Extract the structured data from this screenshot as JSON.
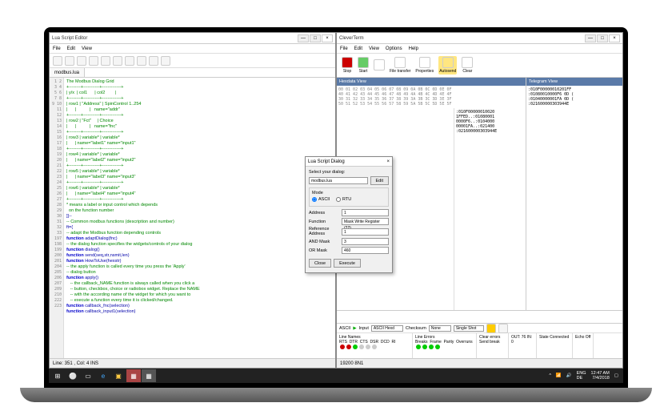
{
  "left_window": {
    "title": "Lua Script Editor",
    "menu": [
      "File",
      "Edit",
      "View"
    ],
    "tab": "modbus.lua",
    "status": "Line: 351 , Col: 4   INS",
    "code_lines": [
      "",
      "The Modbus Dialog Grid",
      "",
      "+--------+-----------+-------------+",
      "| y/x  | col1      | col2        |",
      "+--------+-----------+-------------+",
      "| row1 | \"Address\" | SpinControl 1..254",
      "|      |           |   name=\"addr\"",
      "+--------+-----------+-------------+",
      "| row2 | \"Fct\"     | Choice",
      "|      |           |   name=\"fnc\"",
      "+--------+-----------+-------------+",
      "| row3 | variable* | variable*",
      "|      | name=\"label1\" name=\"input1\"",
      "+--------+-----------+-------------+",
      "| row4 | variable* | variable*",
      "|      | name=\"label2\" name=\"input2\"",
      "+--------+-----------+-------------+",
      "| row5 | variable* | variable*",
      "|      | name=\"label3\" name=\"input3\"",
      "+--------+-----------+-------------+",
      "| row6 | variable* | variable*",
      "|      | name=\"label4\" name=\"input4\"",
      "+--------+-----------+-------------+",
      "",
      "* means a label or input control which depends",
      "  on the function number",
      "]]--",
      "",
      "-- Common modbus functions (description and number)",
      "ft={",
      "-- adapt the Modbus function depending controls",
      "function adaptDialog(fnc)",
      "-- the dialog function specifies the widgets/controls of your dialog",
      "function dialog()",
      "function send(seq,str,nsmit,len)",
      "function HowToUse(hexstr)",
      "-- the apply function is called every time you press the 'Apply'",
      "-- dialog button",
      "function apply()",
      "   -- the callback_NAME function is always called when you click a",
      "   -- button, checkbox, choice or radiobox widget. Replace the NAME",
      "   -- with the according name of the widget for which you want to",
      "   -- execute a function every time it is clicked/changed.",
      "function callback_fnc(selection)",
      "function callback_input1(selection)"
    ]
  },
  "right_window": {
    "title": "CleverTerm",
    "menu": [
      "File",
      "Edit",
      "View",
      "Options",
      "Help"
    ],
    "tools": [
      {
        "label": "Stop",
        "cls": "stop"
      },
      {
        "label": "Start",
        "cls": "start"
      },
      {
        "label": "",
        "cls": ""
      },
      {
        "label": "File transfer",
        "cls": ""
      },
      {
        "label": "Properties",
        "cls": ""
      },
      {
        "label": "Autosend",
        "cls": "auto"
      },
      {
        "label": "Clear",
        "cls": ""
      }
    ],
    "hexhdr": "Hexdata View",
    "telehdr": "Telegram View",
    "hex": "00 01 02 03 04 05 06 07 08 09 0A 0B 0C 0D 0E 0F\n40 41 42 43 44 45 46 47 48 49 4A 4B 4C 4D 4E 4F\n30 31 32 33 34 35 36 37 38 39 3A 3B 3C 3D 3E 3F\n50 51 52 53 54 55 56 57 58 59 5A 5B 5C 5D 5E 5F",
    "tele_a": ":010F00000010020\n1FFED..:01080001\n0000F6..:0104000\n00001FA..:021400\n:021600000303944E",
    "tele_b": ":010F00000010201FF\n:01080010000F6 0D (\n:01040000001FA 0D (\n:021600000303944E",
    "bctl": {
      "mode": "ASCII",
      "input": "Input",
      "hex": "ASCII Hexd",
      "chk": "Checksum",
      "none": "None",
      "shot": "Single Shot"
    },
    "btable": {
      "colA": "Line Names\nRTS  DTR  CTS  DSR  DCD  RI",
      "colB": "Line Errors\nBreaks  Frame  Parity  Overruns",
      "colC": "Clear errors\nSend break",
      "colD": "OUT: 76\nIN: 0",
      "colE": "State\nConnected",
      "colF": "Echo Off"
    },
    "status": "19200 8N1"
  },
  "dialog": {
    "title": "Lua Script Dialog",
    "sel_lbl": "Select your dialog:",
    "file": "modbus.lua",
    "edit": "Edit",
    "mode_lbl": "Mode",
    "r1": "ASCII",
    "r2": "RTU",
    "rows": [
      {
        "l": "Address",
        "v": "1"
      },
      {
        "l": "Function",
        "v": "Mask Write Register (22)"
      },
      {
        "l": "Reference Address",
        "v": "1"
      },
      {
        "l": "AND Mask",
        "v": "3"
      },
      {
        "l": "OR Mask",
        "v": "460"
      }
    ],
    "close": "Close",
    "exec": "Execute"
  },
  "taskbar": {
    "lang": "ENG\nDE",
    "time": "12:47 AM",
    "date": "7/4/2018"
  }
}
